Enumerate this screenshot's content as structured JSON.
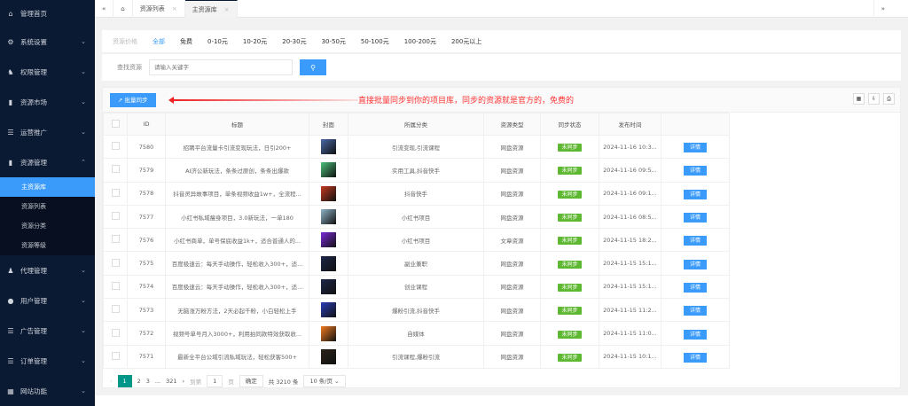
{
  "sidebar": {
    "items": [
      {
        "label": "管理首页",
        "icon": "home-icon",
        "chevron": false
      },
      {
        "label": "系统设置",
        "icon": "gear-icon",
        "chevron": true
      },
      {
        "label": "权限管理",
        "icon": "user-key-icon",
        "chevron": true
      },
      {
        "label": "资源市场",
        "icon": "book-icon",
        "chevron": true
      },
      {
        "label": "运营推广",
        "icon": "list-icon",
        "chevron": true
      },
      {
        "label": "资源管理",
        "icon": "book-icon",
        "chevron": true
      }
    ],
    "sub_items": [
      "主资源库",
      "资源列表",
      "资源分类",
      "资源等级"
    ],
    "items_after": [
      {
        "label": "代理管理",
        "icon": "agent-icon"
      },
      {
        "label": "用户管理",
        "icon": "user-icon"
      },
      {
        "label": "广告管理",
        "icon": "list-icon"
      },
      {
        "label": "订单管理",
        "icon": "list-icon"
      },
      {
        "label": "网站功能",
        "icon": "grid-icon"
      }
    ]
  },
  "tabs": [
    {
      "label": "资源列表"
    },
    {
      "label": "主资源库"
    }
  ],
  "filter": {
    "label": "资源价格",
    "options": [
      "全部",
      "免费",
      "0-10元",
      "10-20元",
      "20-30元",
      "30-50元",
      "50-100元",
      "100-200元",
      "200元以上"
    ]
  },
  "search": {
    "label": "查找资源",
    "placeholder": "请输入关键字"
  },
  "toolbar": {
    "sync_label": "批量同步",
    "note": "直接批量同步到你的项目库，同步的资源就是官方的，免费的"
  },
  "table": {
    "headers": [
      "ID",
      "标题",
      "封面",
      "所属分类",
      "资源类型",
      "同步状态",
      "发布时间",
      ""
    ],
    "rows": [
      {
        "id": "7580",
        "title": "招聘平台流量卡引流变现玩法，日引200+",
        "category": "引流变现,引流课程",
        "type": "网盘资源",
        "status": "未同步",
        "time": "2024-11-16 10:3...",
        "cover": "#4a6aa8"
      },
      {
        "id": "7579",
        "title": "AI济公新玩法，条条过原创，条条出爆款",
        "category": "实用工具,抖音快手",
        "type": "网盘资源",
        "status": "未同步",
        "time": "2024-11-16 09:5...",
        "cover": "#4cbf7a"
      },
      {
        "id": "7578",
        "title": "抖音灵异故事项目，单条视频收益1w+，全流程...",
        "category": "抖音快手",
        "type": "网盘资源",
        "status": "未同步",
        "time": "2024-11-16 09:1...",
        "cover": "#c23a1e"
      },
      {
        "id": "7577",
        "title": "小红书私域瘦身项目，3.0新玩法，一单180",
        "category": "小红书项目",
        "type": "网盘资源",
        "status": "未同步",
        "time": "2024-11-16 08:5...",
        "cover": "#8fb4c8"
      },
      {
        "id": "7576",
        "title": "小红书商单，单号保底收益1k+，适合普通人的...",
        "category": "小红书项目",
        "type": "文章资源",
        "status": "未同步",
        "time": "2024-11-15 18:2...",
        "cover": "#7a2ad8"
      },
      {
        "id": "7575",
        "title": "百度极速云：每天手动操作，轻松收入300+，适...",
        "category": "副业兼职",
        "type": "网盘资源",
        "status": "未同步",
        "time": "2024-11-15 15:1...",
        "cover": "#1c2648"
      },
      {
        "id": "7574",
        "title": "百度极速云：每天手动操作，轻松收入300+，适...",
        "category": "创业课程",
        "type": "网盘资源",
        "status": "未同步",
        "time": "2024-11-15 15:1...",
        "cover": "#1c2648"
      },
      {
        "id": "7573",
        "title": "无脑涨万粉方法，2天必起千粉，小白轻松上手",
        "category": "爆粉引流,抖音快手",
        "type": "网盘资源",
        "status": "未同步",
        "time": "2024-11-15 11:2...",
        "cover": "#2a3cb8"
      },
      {
        "id": "7572",
        "title": "视频号单号月入3000+，利用拍同款特效获取收...",
        "category": "自媒体",
        "type": "网盘资源",
        "status": "未同步",
        "time": "2024-11-15 11:0...",
        "cover": "#f07a20"
      },
      {
        "id": "7571",
        "title": "最新全平台公域引流私域玩法，轻松获客500+",
        "category": "引流课程,爆粉引流",
        "type": "网盘资源",
        "status": "未同步",
        "time": "2024-11-15 10:1...",
        "cover": "#2a2418"
      }
    ],
    "detail_label": "详情"
  },
  "pagination": {
    "pages": [
      "1",
      "2",
      "3"
    ],
    "ellipsis": "...",
    "last": "321",
    "goto_label": "到第",
    "goto_value": "1",
    "page_unit": "页",
    "confirm": "确定",
    "total": "共 3210 条",
    "page_size": "10 条/页"
  }
}
